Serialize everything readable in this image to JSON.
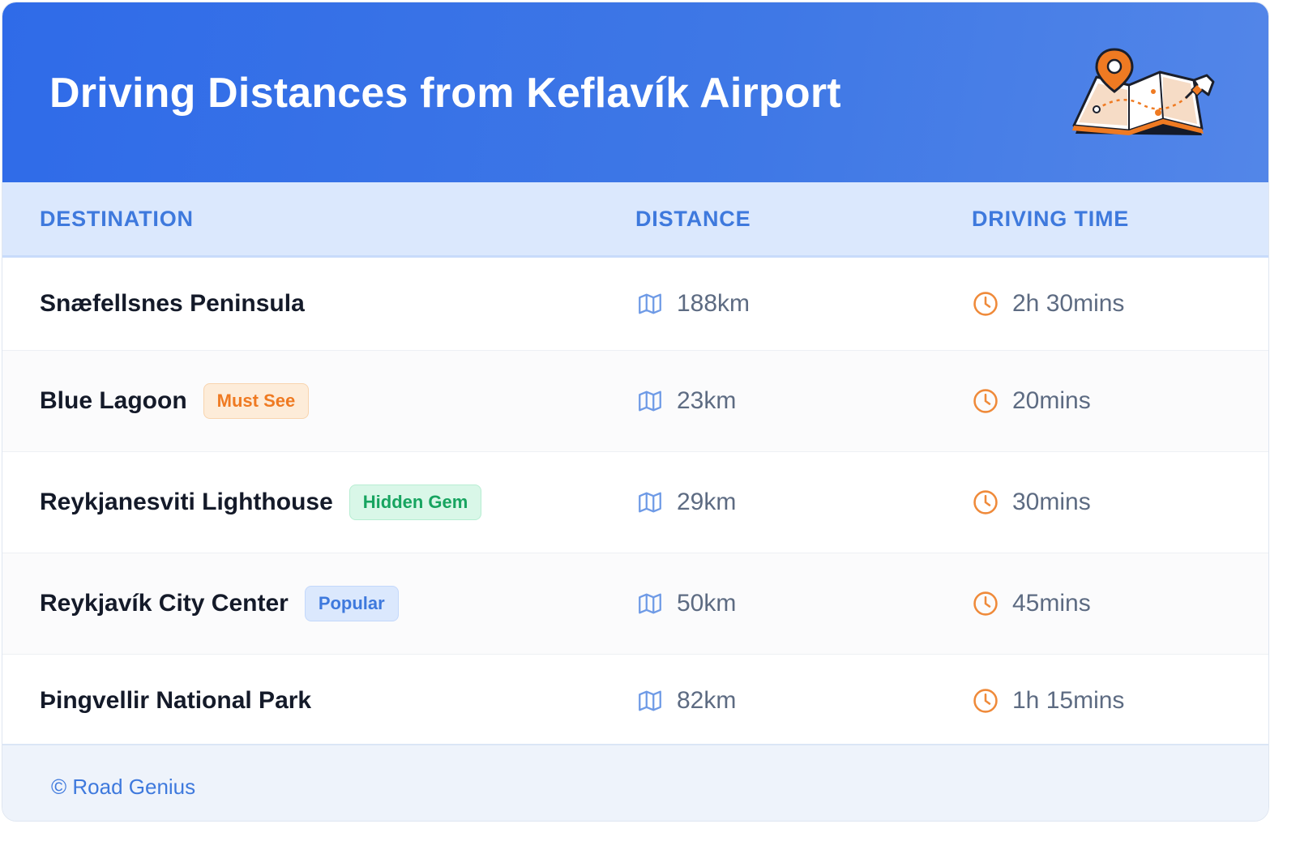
{
  "header": {
    "title": "Driving Distances from Keflavík Airport",
    "illustration": "map-with-pins-icon"
  },
  "columns": {
    "destination": "DESTINATION",
    "distance": "DISTANCE",
    "driving_time": "DRIVING TIME"
  },
  "rows": [
    {
      "destination": "Snæfellsnes Peninsula",
      "badge": "",
      "distance": "188km",
      "time": "2h 30mins"
    },
    {
      "destination": "Blue Lagoon",
      "badge": "Must See",
      "badge_color": "#ef7a22",
      "distance": "23km",
      "time": "20mins"
    },
    {
      "destination": "Reykjanesviti Lighthouse",
      "badge": "Hidden Gem",
      "badge_color": "#17a460",
      "distance": "29km",
      "time": "30mins"
    },
    {
      "destination": "Reykjavík City Center",
      "badge": "Popular",
      "badge_color": "#3e79dd",
      "distance": "50km",
      "time": "45mins"
    },
    {
      "destination": "Þingvellir National Park",
      "badge": "",
      "distance": "82km",
      "time": "1h 15mins"
    }
  ],
  "icons": {
    "distance": "map-icon",
    "time": "clock-icon"
  },
  "footer": {
    "credit": "© Road Genius"
  },
  "colors": {
    "header_blue": "#2f6be8",
    "accent_blue": "#3e79dd",
    "accent_orange": "#ef8a3a"
  }
}
